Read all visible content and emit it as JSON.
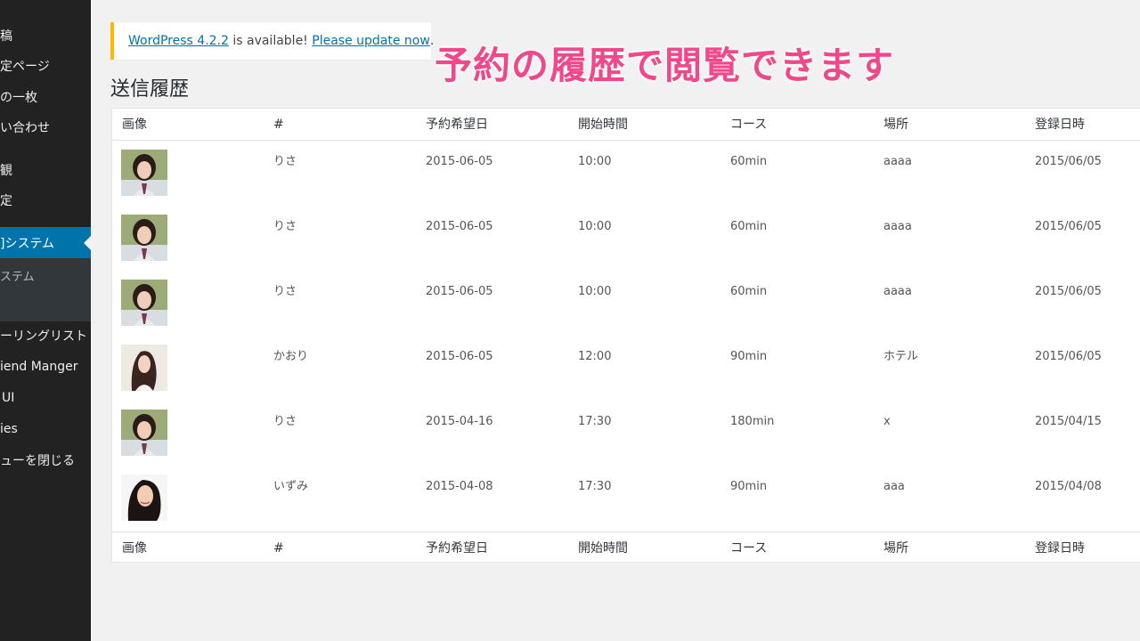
{
  "sidebar": {
    "items": [
      {
        "label": "稿",
        "align": "left"
      },
      {
        "label": "定ページ",
        "align": "left"
      },
      {
        "label": "の一枚",
        "align": "left"
      },
      {
        "label": "い合わせ",
        "align": "left"
      },
      {
        "label": "観",
        "align": "left"
      },
      {
        "label": "定",
        "align": "left"
      },
      {
        "label": "]システム",
        "align": "left"
      },
      {
        "label": "ーリングリスト",
        "align": "left"
      },
      {
        "label": "iend Manger",
        "align": "left"
      },
      {
        "label": "UI",
        "align": "left"
      },
      {
        "label": "ies",
        "align": "left"
      },
      {
        "label": "ューを閉じる",
        "align": "left"
      }
    ],
    "submenu_item": "ステム"
  },
  "notice": {
    "link1": "WordPress 4.2.2",
    "text1": " is available! ",
    "link2": "Please update now",
    "text2": "."
  },
  "caption": "予約の履歴で閲覧できます",
  "page_title": "送信履歴",
  "table": {
    "headers": [
      "画像",
      "#",
      "予約希望日",
      "開始時間",
      "コース",
      "場所",
      "登録日時"
    ],
    "rows": [
      {
        "name": "りさ",
        "date": "2015-06-05",
        "time": "10:00",
        "course": "60min",
        "place": "aaaa",
        "registered": "2015/06/05"
      },
      {
        "name": "りさ",
        "date": "2015-06-05",
        "time": "10:00",
        "course": "60min",
        "place": "aaaa",
        "registered": "2015/06/05"
      },
      {
        "name": "りさ",
        "date": "2015-06-05",
        "time": "10:00",
        "course": "60min",
        "place": "aaaa",
        "registered": "2015/06/05"
      },
      {
        "name": "かおり",
        "date": "2015-06-05",
        "time": "12:00",
        "course": "90min",
        "place": "ホテル",
        "registered": "2015/06/05"
      },
      {
        "name": "りさ",
        "date": "2015-04-16",
        "time": "17:30",
        "course": "180min",
        "place": "x",
        "registered": "2015/04/15"
      },
      {
        "name": "いずみ",
        "date": "2015-04-08",
        "time": "17:30",
        "course": "90min",
        "place": "aaa",
        "registered": "2015/04/08"
      }
    ]
  },
  "colors": {
    "sidebar_bg": "#222222",
    "active_bg": "#0073aa",
    "notice_border": "#ffb900",
    "caption": "#f0488a",
    "link": "#0073aa"
  }
}
